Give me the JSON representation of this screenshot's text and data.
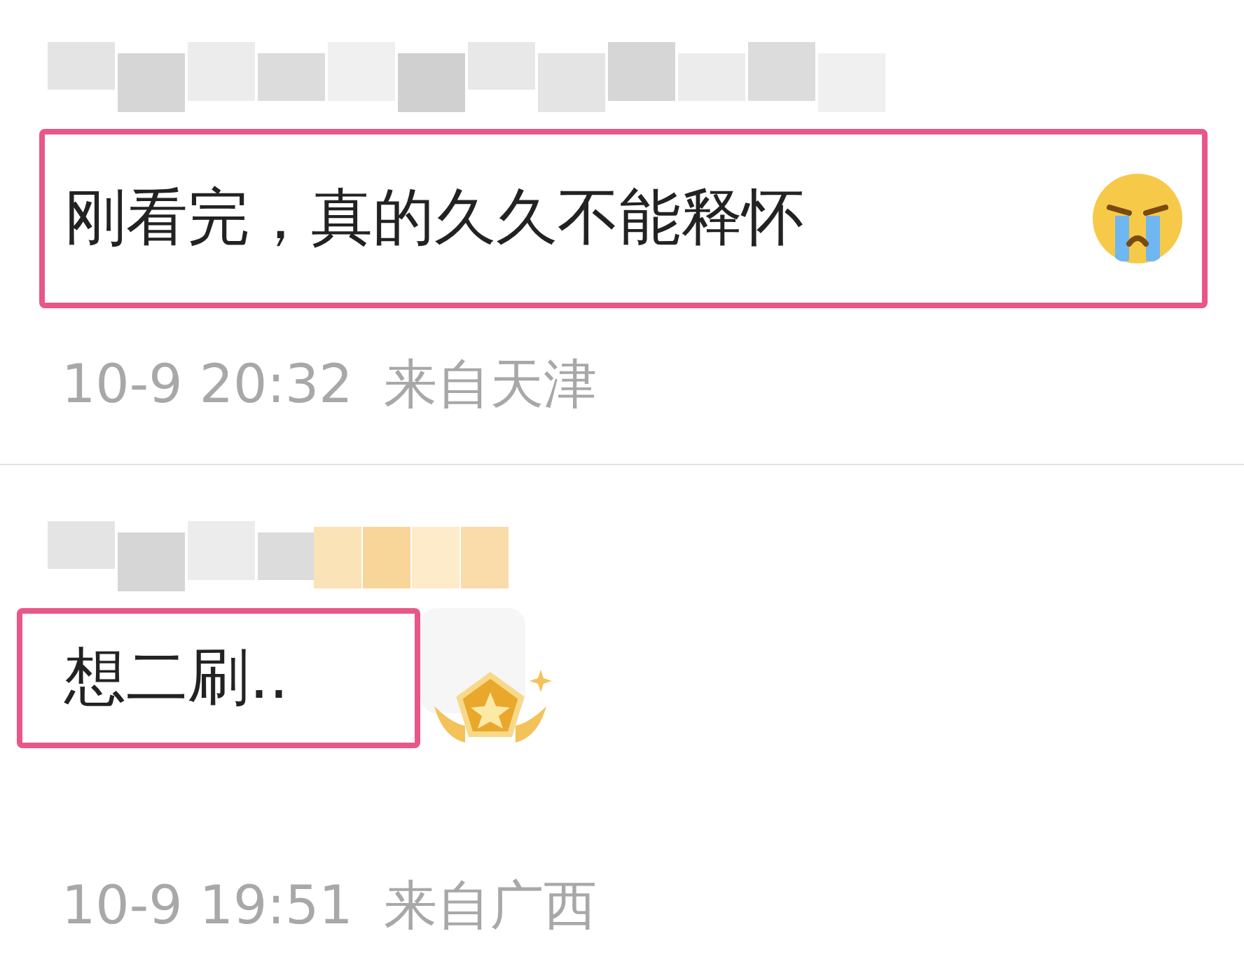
{
  "comments": [
    {
      "kind": "emoji",
      "text": "刚看完，真的久久不能释怀",
      "date": "10-9 20:32",
      "location": "来自天津"
    },
    {
      "kind": "badge",
      "text": "想二刷..",
      "date": "10-9 19:51",
      "location": "来自广西"
    }
  ]
}
